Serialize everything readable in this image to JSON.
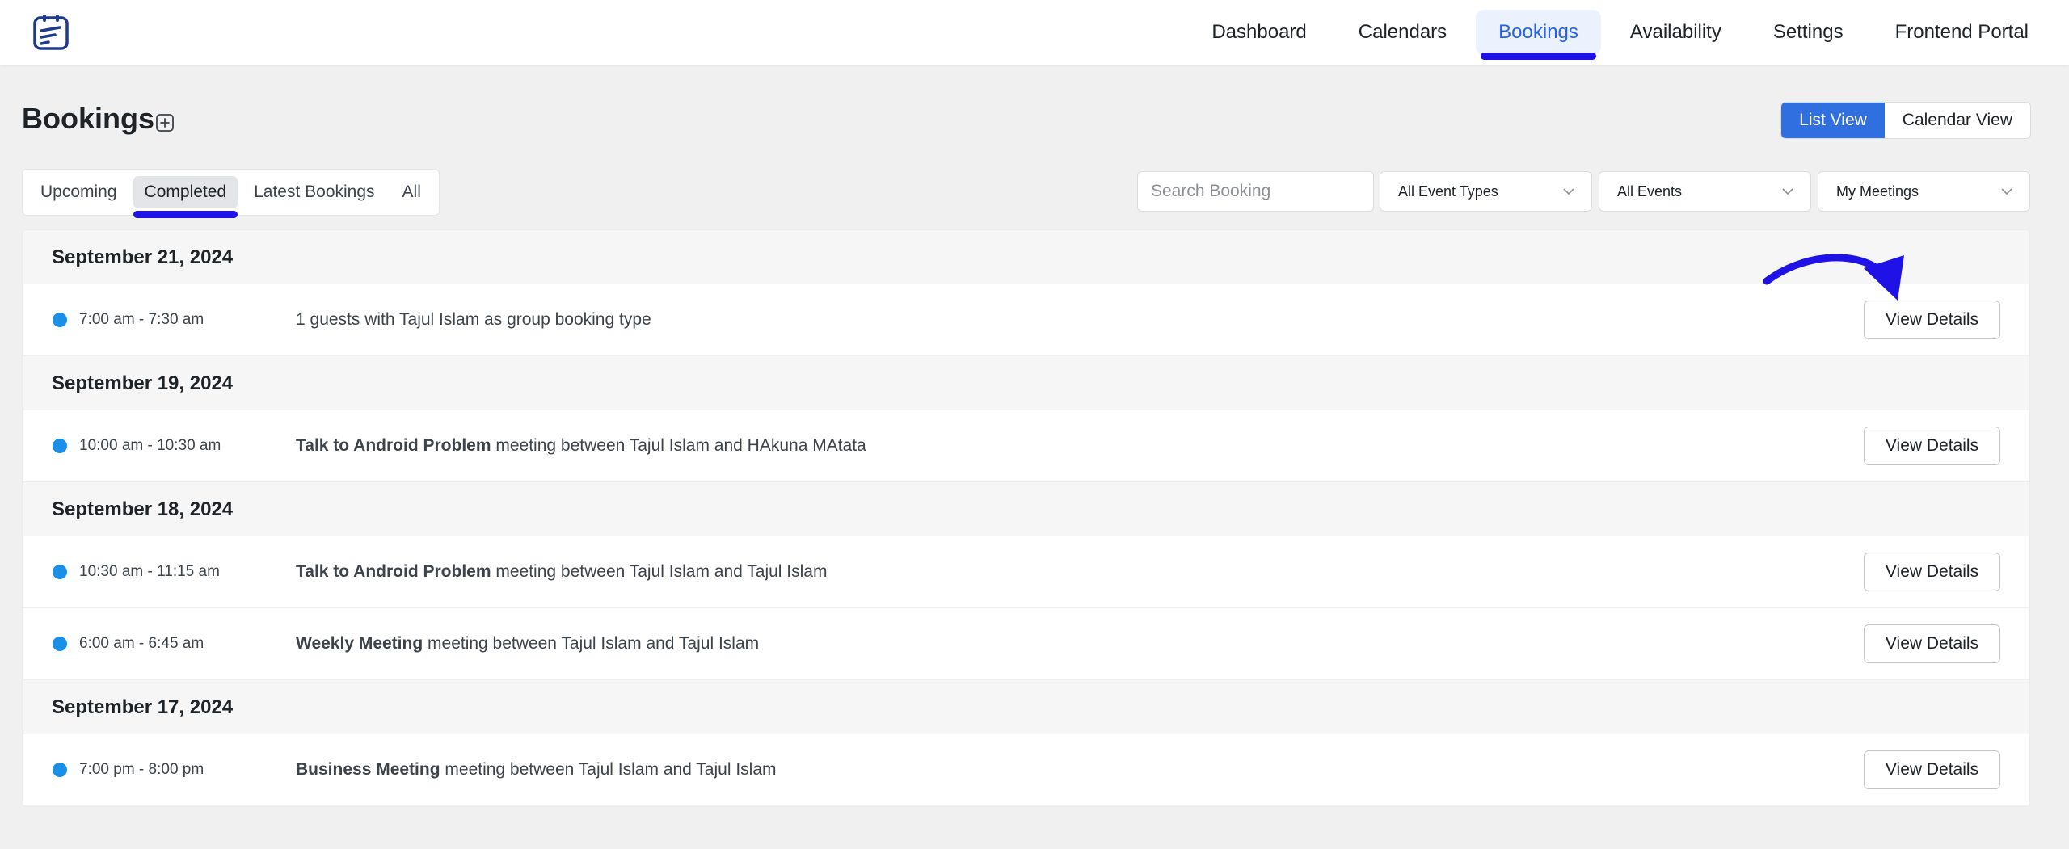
{
  "nav": {
    "items": [
      {
        "label": "Dashboard",
        "active": false
      },
      {
        "label": "Calendars",
        "active": false
      },
      {
        "label": "Bookings",
        "active": true
      },
      {
        "label": "Availability",
        "active": false
      },
      {
        "label": "Settings",
        "active": false
      },
      {
        "label": "Frontend Portal",
        "active": false
      }
    ]
  },
  "page": {
    "title": "Bookings"
  },
  "view_toggle": {
    "list": "List View",
    "calendar": "Calendar View",
    "active": "list"
  },
  "tabs": [
    {
      "label": "Upcoming",
      "active": false
    },
    {
      "label": "Completed",
      "active": true
    },
    {
      "label": "Latest Bookings",
      "active": false
    },
    {
      "label": "All",
      "active": false
    }
  ],
  "filters": {
    "search_placeholder": "Search Booking",
    "event_types": "All Event Types",
    "events": "All Events",
    "meetings": "My Meetings"
  },
  "groups": [
    {
      "date": "September 21, 2024",
      "bookings": [
        {
          "time": "7:00 am - 7:30 am",
          "title": "",
          "text": "1 guests with Tajul Islam as group booking type",
          "button": "View Details"
        }
      ]
    },
    {
      "date": "September 19, 2024",
      "bookings": [
        {
          "time": "10:00 am - 10:30 am",
          "title": "Talk to Android Problem",
          "text": "meeting between Tajul Islam and HAkuna MAtata",
          "button": "View Details"
        }
      ]
    },
    {
      "date": "September 18, 2024",
      "bookings": [
        {
          "time": "10:30 am - 11:15 am",
          "title": "Talk to Android Problem",
          "text": "meeting between Tajul Islam and Tajul Islam",
          "button": "View Details"
        },
        {
          "time": "6:00 am - 6:45 am",
          "title": "Weekly Meeting",
          "text": "meeting between Tajul Islam and Tajul Islam",
          "button": "View Details"
        }
      ]
    },
    {
      "date": "September 17, 2024",
      "bookings": [
        {
          "time": "7:00 pm - 8:00 pm",
          "title": "Business Meeting",
          "text": "meeting between Tajul Islam and Tajul Islam",
          "button": "View Details"
        }
      ]
    }
  ],
  "colors": {
    "accent": "#2f6fe0",
    "highlight": "#1e12e6",
    "status_dot": "#1a8fe8"
  }
}
